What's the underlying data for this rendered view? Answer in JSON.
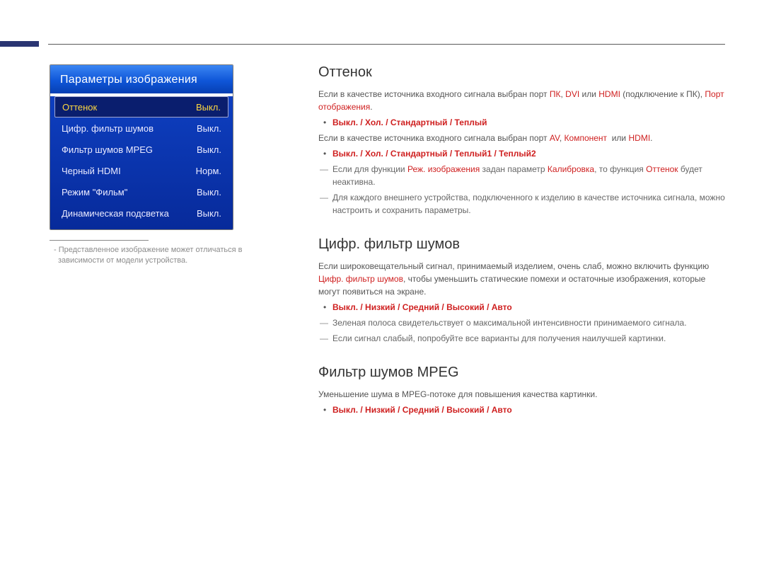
{
  "menu": {
    "title": "Параметры изображения",
    "items": [
      {
        "label": "Оттенок",
        "value": "Выкл.",
        "selected": true
      },
      {
        "label": "Цифр. фильтр шумов",
        "value": "Выкл.",
        "selected": false
      },
      {
        "label": "Фильтр шумов MPEG",
        "value": "Выкл.",
        "selected": false
      },
      {
        "label": "Черный HDMI",
        "value": "Норм.",
        "selected": false
      },
      {
        "label": "Режим \"Фильм\"",
        "value": "Выкл.",
        "selected": false
      },
      {
        "label": "Динамическая подсветка",
        "value": "Выкл.",
        "selected": false
      }
    ]
  },
  "footnote": "Представленное изображение может отличаться в зависимости от модели устройства.",
  "section1": {
    "title": "Оттенок",
    "intro_plain_a": "Если в качестве источника входного сигнала выбран порт ",
    "s_pk": "ПК",
    "s_dvi": "DVI",
    "s_or": " или ",
    "s_hdmi": "HDMI",
    "intro_plain_b": " (подключение к ПК), ",
    "s_port": "Порт отображения",
    "intro_plain_c": ".",
    "opts1": "Выкл. / Хол. / Стандартный / Теплый",
    "intro2_a": "Если в качестве источника входного сигнала выбран порт ",
    "s_av": "AV",
    "s_comp": "Компонент",
    "opts2": "Выкл. / Хол. / Стандартный / Теплый1 / Теплый2",
    "note1_a": "Если для функции ",
    "s_rezh": "Реж. изображения",
    "note1_b": " задан параметр ",
    "s_kal": "Калибровка",
    "note1_c": ", то функция ",
    "s_ott": "Оттенок",
    "note1_d": " будет неактивна.",
    "note2": "Для каждого внешнего устройства, подключенного к изделию в качестве источника сигнала, можно настроить и сохранить параметры."
  },
  "section2": {
    "title": "Цифр. фильтр шумов",
    "intro_a": "Если широковещательный сигнал, принимаемый изделием, очень слаб, можно включить функцию ",
    "s_cf": "Цифр. фильтр шумов",
    "intro_b": ", чтобы уменьшить статические помехи и остаточные изображения, которые могут появиться на экране.",
    "opts": "Выкл. / Низкий / Средний / Высокий / Авто",
    "note1": "Зеленая полоса свидетельствует о максимальной интенсивности принимаемого сигнала.",
    "note2": "Если сигнал слабый, попробуйте все варианты для получения наилучшей картинки."
  },
  "section3": {
    "title": "Фильтр шумов MPEG",
    "intro": "Уменьшение шума в MPEG-потоке для повышения качества картинки.",
    "opts": "Выкл. / Низкий / Средний / Высокий / Авто"
  }
}
